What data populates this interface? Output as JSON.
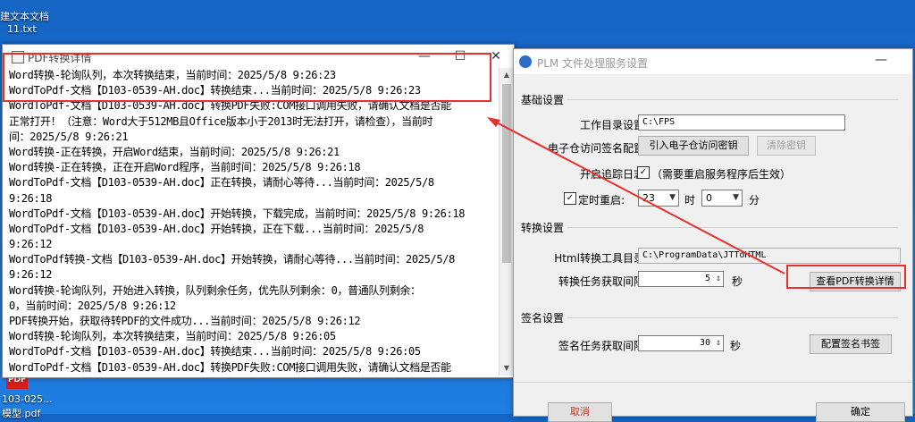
{
  "desktop": {
    "file1_label": "建文本文档",
    "file2_label": "11.txt",
    "pdf_icon_text": "PDF",
    "pdf_file_label1": "103-025...",
    "pdf_file_label2": "模型.pdf"
  },
  "pdf_window": {
    "title": "PDF转换详情",
    "controls": {
      "minimize": "—",
      "maximize": "☐",
      "close": "✕"
    },
    "log_lines": [
      "Word转换-轮询队列，本次转换结束，当前时间：2025/5/8 9:26:23",
      "WordToPdf-文档【D103-0539-AH.doc】转换结束...当前时间：2025/5/8 9:26:23",
      "WordToPdf-文档【D103-0539-AH.doc】转换PDF失败:COM接口调用失败，请确认文档是否能",
      "正常打开！（注意：Word大于512MB且Office版本小于2013时无法打开，请检查），当前时",
      "间：2025/5/8 9:26:21",
      "Word转换-正在转换，开启Word结束，当前时间：2025/5/8 9:26:21",
      "Word转换-正在转换，正在开启Word程序，当前时间：2025/5/8 9:26:18",
      "WordToPdf-文档【D103-0539-AH.doc】正在转换，请耐心等待...当前时间：2025/5/8",
      "9:26:18",
      "WordToPdf-文档【D103-0539-AH.doc】开始转换，下载完成，当前时间：2025/5/8 9:26:18",
      "WordToPdf-文档【D103-0539-AH.doc】开始转换，正在下载...当前时间：2025/5/8",
      "9:26:12",
      "WordToPdf转换-文档【D103-0539-AH.doc】开始转换，请耐心等待...当前时间：2025/5/8",
      "9:26:12",
      "Word转换-轮询队列，开始进入转换，队列剩余任务，优先队列剩余：0，普通队列剩余：",
      "0，当前时间：2025/5/8 9:26:12",
      "PDF转换开始，获取待转PDF的文件成功...当前时间：2025/5/8 9:26:12",
      "Word转换-轮询队列，本次转换结束，当前时间：2025/5/8 9:26:05",
      "WordToPdf-文档【D103-0539-AH.doc】转换结束...当前时间：2025/5/8 9:26:05",
      "WordToPdf-文档【D103-0539-AH.doc】转换PDF失败:COM接口调用失败，请确认文档是否能"
    ]
  },
  "plm_window": {
    "title": "PLM 文件处理服务设置",
    "minimize": "—",
    "basic_group": "基础设置",
    "workdir_label": "工作目录设置:",
    "workdir_value": "C:\\FPS",
    "e_cert_label": "电子仓访问签名配置:",
    "import_key_button": "引入电子仓访问密钥",
    "clear_key_button": "清除密钥",
    "tracking_log_label": "开启追踪日志:",
    "tracking_log_checked": "✓",
    "tracking_log_note": "（需要重启服务程序后生效）",
    "timed_restart_checked": "✓",
    "timed_restart_label": "定时重启:",
    "hour_value": "23",
    "hour_unit": "时",
    "minute_value": "0",
    "minute_unit": "分",
    "convert_group": "转换设置",
    "html_tool_label": "Html转换工具目录:",
    "html_tool_value": "C:\\ProgramData\\JTToHTML",
    "convert_interval_label": "转换任务获取间隔:",
    "convert_interval_value": "5",
    "seconds_unit": "秒",
    "view_pdf_details_button": "查看PDF转换详情",
    "sign_group": "签名设置",
    "sign_interval_label": "签名任务获取间隔:",
    "sign_interval_value": "30",
    "sign_seconds_unit": "秒",
    "config_sign_button": "配置签名书签",
    "cancel_button": "取消",
    "ok_button": "确定"
  },
  "annotation": {
    "highlight_color": "#e8302c"
  }
}
